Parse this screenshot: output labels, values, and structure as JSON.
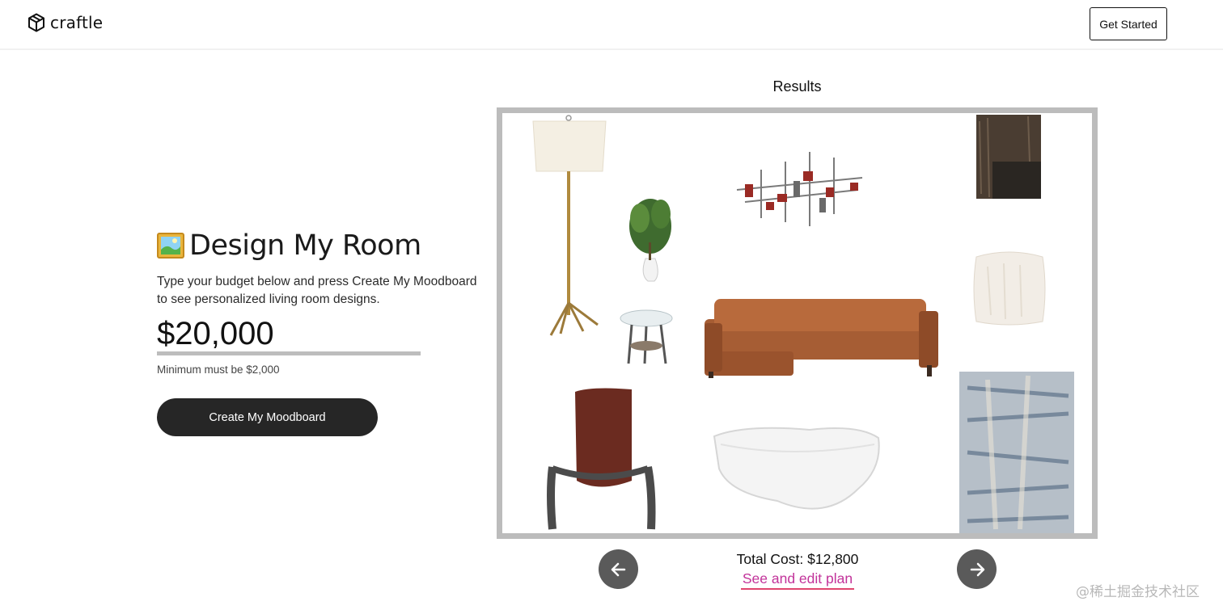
{
  "header": {
    "brand": "craftle",
    "logo_icon": "cube-logo-icon",
    "cta_label": "Get Started"
  },
  "hero": {
    "emoji_icon": "framed-picture-icon",
    "title": "Design My Room",
    "description": "Type your budget below and press Create My Moodboard to see personalized living room designs.",
    "budget_value": "$20,000",
    "hint": "Minimum must be $2,000",
    "create_label": "Create My Moodboard"
  },
  "results": {
    "title": "Results",
    "items": [
      "floor-lamp",
      "potted-plant",
      "metal-wall-art",
      "fur-throw-blanket",
      "faux-fur-pillow",
      "glass-side-table",
      "leather-sectional-sofa",
      "leather-sling-chair",
      "white-coffee-table",
      "distressed-area-rug"
    ],
    "total_cost": "Total Cost: $12,800",
    "edit_link": "See and edit plan",
    "prev_icon": "arrow-left-icon",
    "next_icon": "arrow-right-icon"
  },
  "watermark": "@稀土掘金技术社区",
  "colors": {
    "accent_link": "#c2339a",
    "link_underline": "#e0456f",
    "dark_button": "#262626",
    "nav_button": "#5a5a5a",
    "board_border": "#bcbcbc"
  }
}
